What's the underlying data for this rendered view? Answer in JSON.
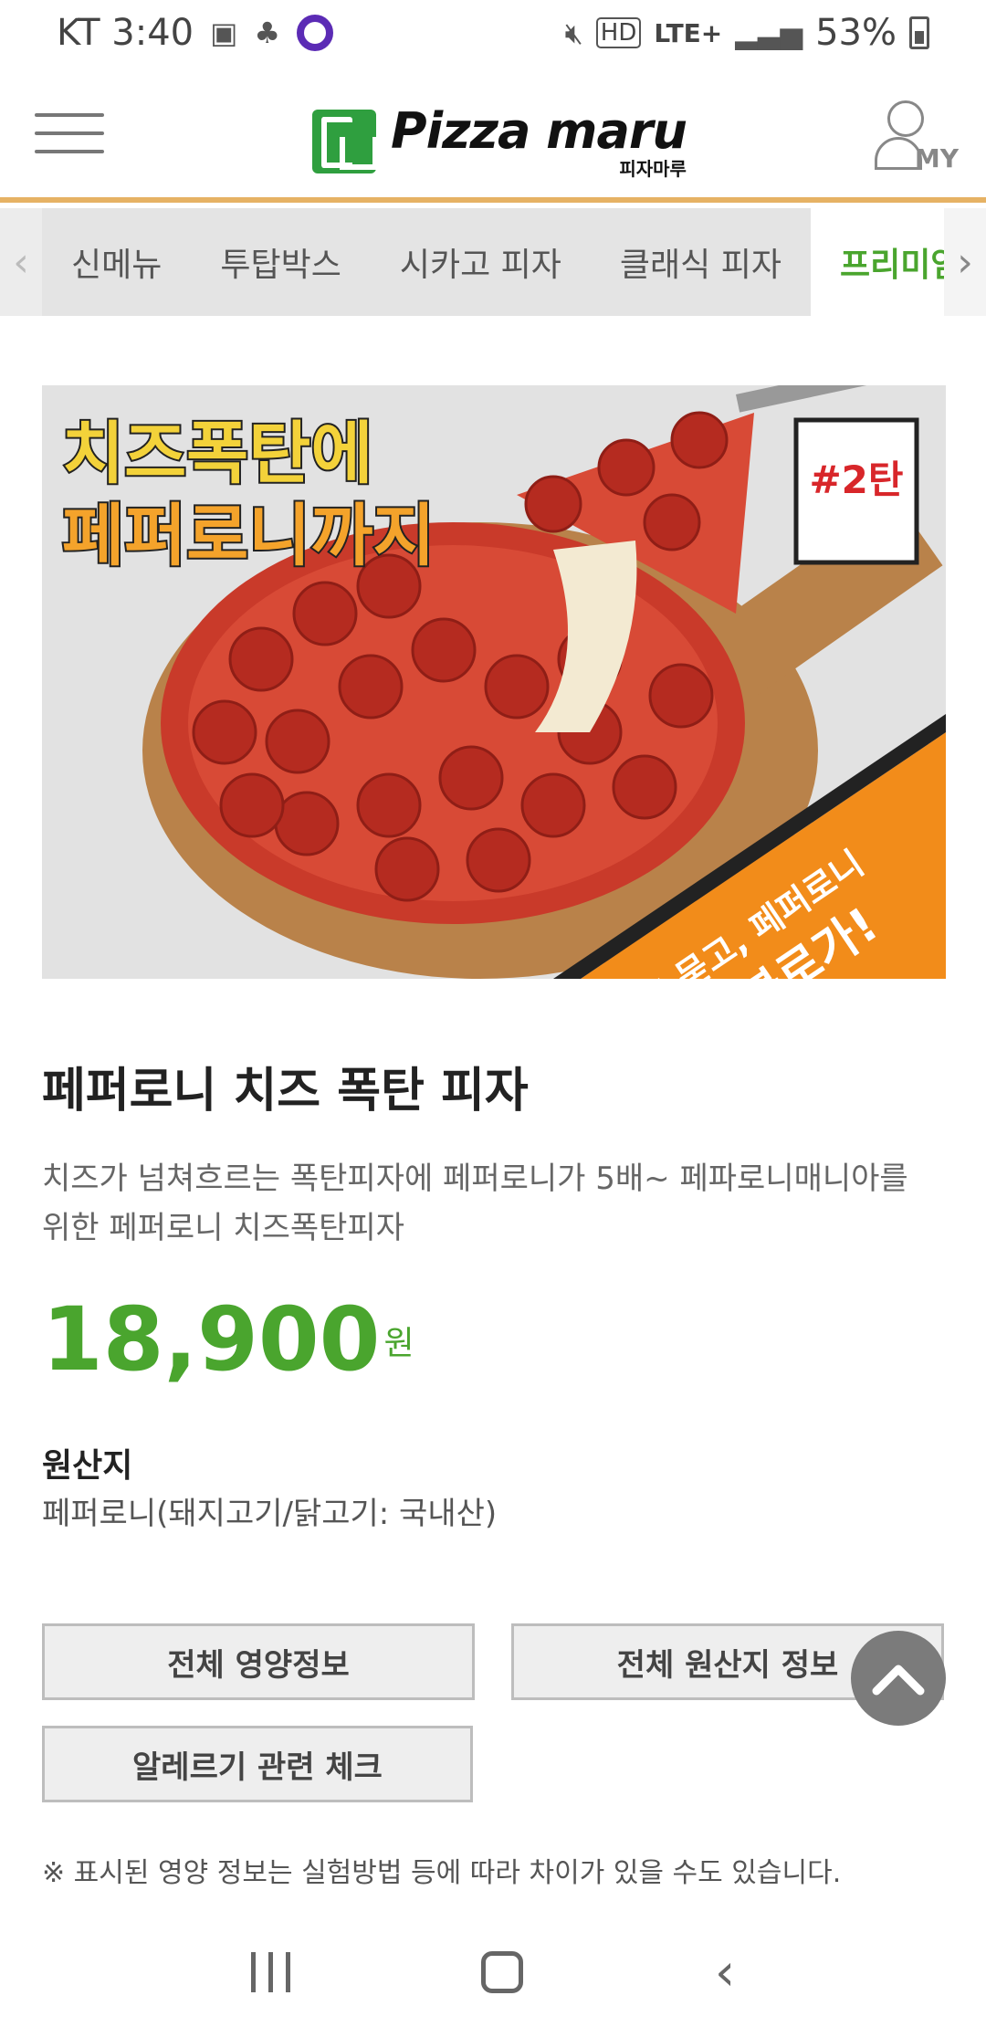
{
  "status_bar": {
    "carrier_time": "KT 3:40",
    "network": "LTE+",
    "hd": "HD",
    "battery": "53%"
  },
  "header": {
    "logo_name": "Pizza maru",
    "logo_sub": "피자마루",
    "my_label": "MY"
  },
  "tabs": [
    {
      "label": "신메뉴"
    },
    {
      "label": "투탑박스"
    },
    {
      "label": "시카고 피자"
    },
    {
      "label": "클래식 피자"
    },
    {
      "label": "프리미엄"
    }
  ],
  "banner": {
    "headline_1": "치즈폭탄에",
    "headline_2": "페퍼로니까지",
    "tag": "#2탄",
    "corner_1": "치즈 묻고, 페퍼로니",
    "corner_2": "더블로가!"
  },
  "product": {
    "title": "페퍼로니 치즈 폭탄 피자",
    "description": "치즈가 넘쳐흐르는 폭탄피자에 페퍼로니가 5배~ 페파로니매니아를 위한 페퍼로니 치즈폭탄피자",
    "price": "18,900",
    "price_unit": "원",
    "origin_label": "원산지",
    "origin_value": "페퍼로니(돼지고기/닭고기: 국내산)"
  },
  "buttons": {
    "nutrition": "전체 영양정보",
    "origin": "전체 원산지 정보",
    "allergy": "알레르기 관련 체크"
  },
  "notice": "※ 표시된 영양 정보는 실험방법 등에 따라 차이가 있을 수도 있습니다.",
  "colors": {
    "accent_green": "#4aa52e",
    "header_border": "#e6b264",
    "banner_orange": "#f28c1a"
  }
}
